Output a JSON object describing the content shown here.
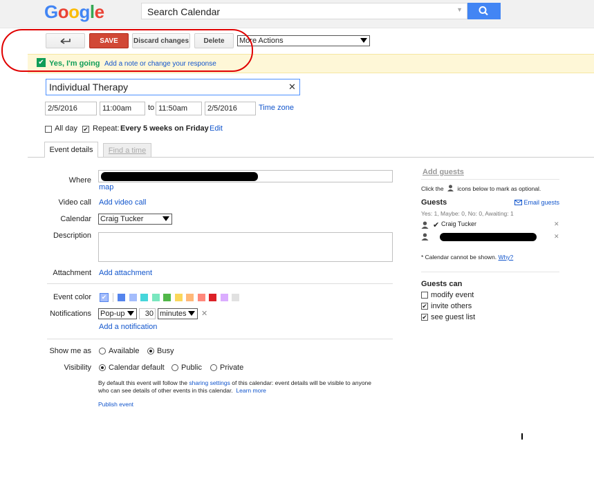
{
  "header": {
    "logo_letters": [
      {
        "ch": "G",
        "color": "#4285f4"
      },
      {
        "ch": "o",
        "color": "#ea4335"
      },
      {
        "ch": "o",
        "color": "#fbbc05"
      },
      {
        "ch": "g",
        "color": "#4285f4"
      },
      {
        "ch": "l",
        "color": "#34a853"
      },
      {
        "ch": "e",
        "color": "#ea4335"
      }
    ],
    "search_value": "Search Calendar"
  },
  "toolbar": {
    "save_label": "SAVE",
    "discard_label": "Discard changes",
    "delete_label": "Delete",
    "more_actions": "More Actions"
  },
  "rsvp": {
    "status": "Yes, I'm going",
    "note_link": "Add a note or change your response"
  },
  "event": {
    "title": "Individual Therapy",
    "start_date": "2/5/2016",
    "start_time": "11:00am",
    "to": "to",
    "end_time": "11:50am",
    "end_date": "2/5/2016",
    "timezone": "Time zone",
    "all_day": "All day",
    "repeat_label": "Repeat:",
    "repeat_value": "Every 5 weeks on Friday",
    "repeat_edit": "Edit"
  },
  "tabs": {
    "details": "Event details",
    "find_time": "Find a time"
  },
  "details": {
    "where_label": "Where",
    "map_link": "map",
    "video_label": "Video call",
    "video_link": "Add video call",
    "calendar_label": "Calendar",
    "calendar_value": "Craig Tucker",
    "description_label": "Description",
    "attachment_label": "Attachment",
    "attachment_link": "Add attachment",
    "color_label": "Event color",
    "colors": [
      "#a4bdfc",
      "#5484ed",
      "#a4bdfc",
      "#46d6db",
      "#7ae7bf",
      "#51b749",
      "#fbd75b",
      "#ffb878",
      "#ff887c",
      "#dc2127",
      "#dbadff",
      "#e1e1e1"
    ],
    "notifications_label": "Notifications",
    "notif_type": "Pop-up",
    "notif_amount": "30",
    "notif_unit": "minutes",
    "add_notification": "Add a notification",
    "show_me_as_label": "Show me as",
    "available": "Available",
    "busy": "Busy",
    "visibility_label": "Visibility",
    "vis_default": "Calendar default",
    "vis_public": "Public",
    "vis_private": "Private",
    "info_1": "By default this event will follow the ",
    "info_link": "sharing settings",
    "info_2": " of this calendar: event details will be visible to anyone",
    "info_3": "who can see details of other events in this calendar.",
    "learn_more": "Learn more",
    "publish": "Publish event"
  },
  "guests": {
    "add_guests": "Add guests",
    "hint_a": "Click the",
    "hint_b": "icons below to mark as optional.",
    "title": "Guests",
    "email_link": "Email guests",
    "summary": "Yes: 1, Maybe: 0, No: 0, Awaiting: 1",
    "guest1": "Craig Tucker",
    "note": "* Calendar cannot be shown.",
    "why": "Why?",
    "can_title": "Guests can",
    "perm_modify": "modify event",
    "perm_invite": "invite others",
    "perm_see": "see guest list"
  },
  "icons": {
    "back": "arrow-back-icon",
    "search": "search-icon",
    "close": "close-icon",
    "check": "checkmark-icon",
    "person": "person-icon",
    "mail": "mail-icon"
  }
}
